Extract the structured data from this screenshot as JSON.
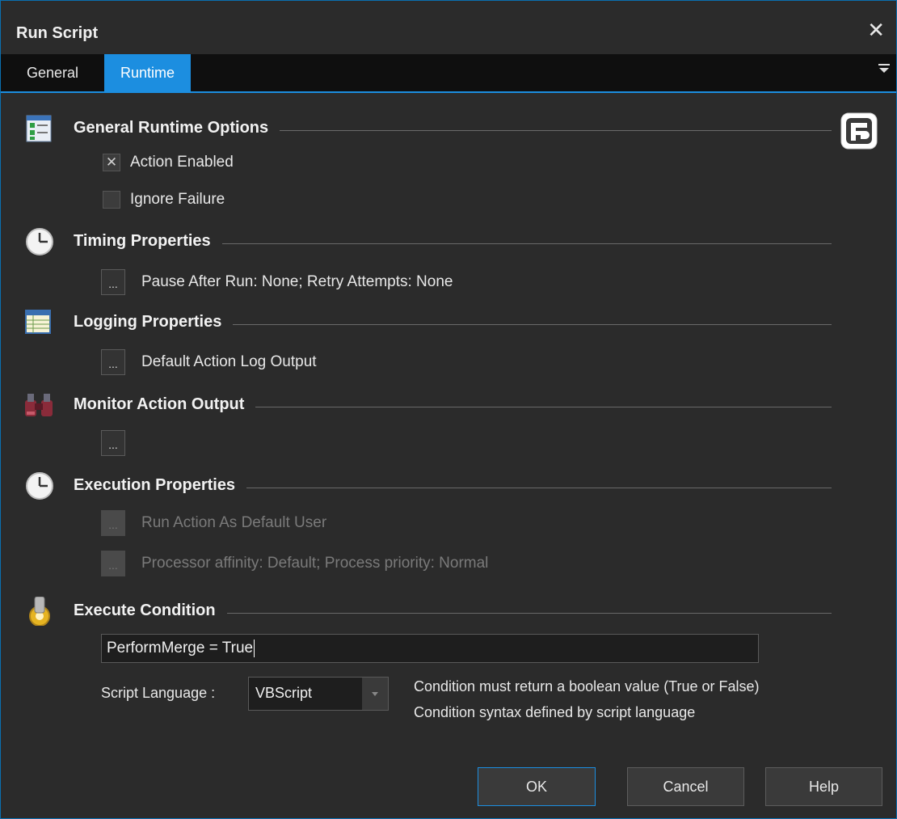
{
  "window": {
    "title": "Run Script"
  },
  "tabs": [
    {
      "label": "General",
      "active": false
    },
    {
      "label": "Runtime",
      "active": true
    }
  ],
  "sections": {
    "general_runtime": {
      "title": "General Runtime Options",
      "icon": "checklist-icon"
    },
    "timing": {
      "title": "Timing Properties",
      "icon": "clock-icon"
    },
    "logging": {
      "title": "Logging Properties",
      "icon": "log-table-icon"
    },
    "monitor": {
      "title": "Monitor Action Output",
      "icon": "binoculars-icon"
    },
    "execution": {
      "title": "Execution Properties",
      "icon": "clock-icon"
    },
    "execute_condition": {
      "title": "Execute Condition",
      "icon": "gear-cylinder-icon"
    }
  },
  "options": {
    "action_enabled": {
      "label": "Action Enabled",
      "checked": true
    },
    "ignore_failure": {
      "label": "Ignore Failure",
      "checked": false
    }
  },
  "timing": {
    "summary": "Pause After Run: None; Retry Attempts: None"
  },
  "logging": {
    "summary": "Default Action Log Output"
  },
  "monitor": {
    "summary": ""
  },
  "execution": {
    "run_as": "Run Action As Default User",
    "affinity": "Processor affinity: Default; Process priority: Normal"
  },
  "button_dots": "...",
  "condition": {
    "value": "PerformMerge = True",
    "language_label": "Script Language :",
    "language_value": "VBScript",
    "note1": "Condition must return a boolean value (True or False)",
    "note2": "Condition syntax defined by script language"
  },
  "buttons": {
    "ok": "OK",
    "cancel": "Cancel",
    "help": "Help"
  },
  "colors": {
    "accent": "#1c8ee0",
    "background": "#2b2b2b",
    "tabstrip": "#0f0f0f"
  }
}
